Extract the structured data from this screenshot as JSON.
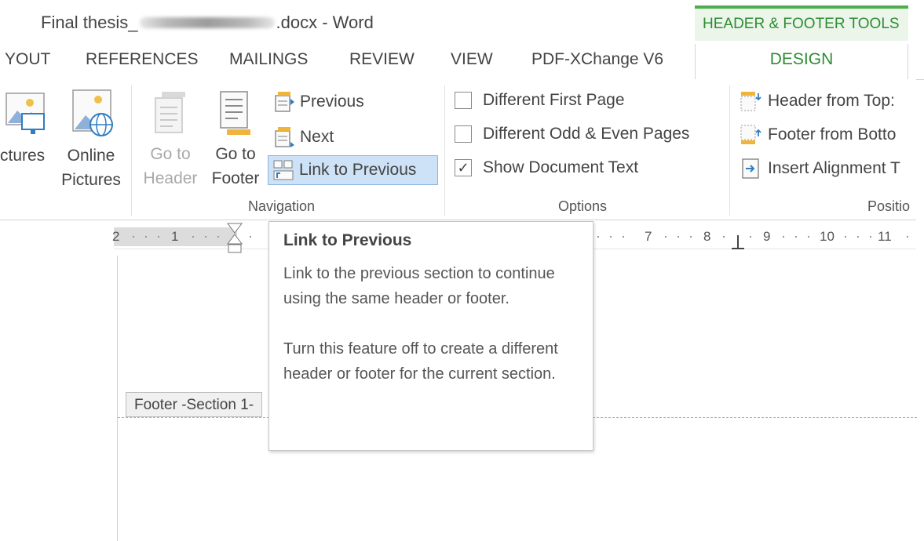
{
  "titlebar": {
    "title_prefix": "Final thesis_",
    "title_suffix": ".docx - Word",
    "contextual_label": "HEADER & FOOTER TOOLS"
  },
  "tabs": [
    "YOUT",
    "REFERENCES",
    "MAILINGS",
    "REVIEW",
    "VIEW",
    "PDF-XChange V6"
  ],
  "active_tab": "DESIGN",
  "ribbon": {
    "insert": {
      "pictures_line1": "ctures",
      "online_line1": "Online",
      "online_line2": "Pictures"
    },
    "navigation": {
      "goto_header_line1": "Go to",
      "goto_header_line2": "Header",
      "goto_footer_line1": "Go to",
      "goto_footer_line2": "Footer",
      "previous": "Previous",
      "next": "Next",
      "link_to_previous": "Link to Previous",
      "group_label": "Navigation"
    },
    "options": {
      "different_first_page": "Different First Page",
      "different_odd_even": "Different Odd & Even Pages",
      "show_document_text": "Show Document Text",
      "show_document_text_checked": true,
      "group_label": "Options"
    },
    "position": {
      "header_from_top": "Header from Top:",
      "footer_from_bottom": "Footer from Botto",
      "insert_alignment_tab": "Insert Alignment T",
      "group_label": "Positio"
    }
  },
  "ruler": {
    "numbers_left": [
      "2",
      "1"
    ],
    "numbers_right": [
      "7",
      "8",
      "9",
      "10",
      "11"
    ]
  },
  "document": {
    "footer_tag": "Footer -Section 1-"
  },
  "tooltip": {
    "title": "Link to Previous",
    "para1": "Link to the previous section to continue using the same header or footer.",
    "para2": "Turn this feature off to create a different header or footer for the current section."
  },
  "colors": {
    "accent_green": "#2e8c33",
    "contextual_bg": "#ebf5ea",
    "highlight_blue": "#cde2f6"
  }
}
